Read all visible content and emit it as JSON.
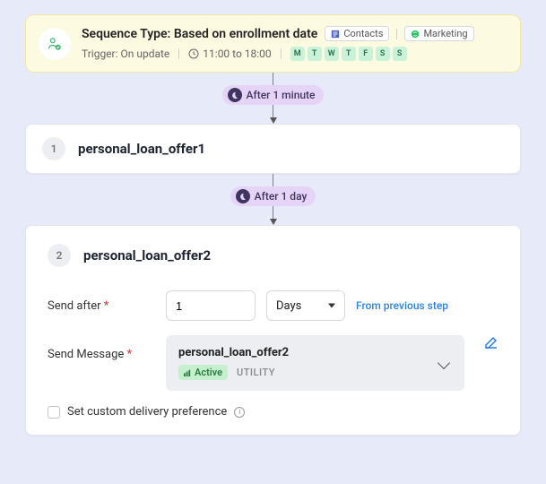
{
  "sequence": {
    "title": "Sequence Type: Based on enrollment date",
    "tags": {
      "contacts": "Contacts",
      "marketing": "Marketing"
    },
    "trigger_label": "Trigger: On update",
    "time_window": "11:00 to 18:00",
    "days": [
      "M",
      "T",
      "W",
      "T",
      "F",
      "S",
      "S"
    ]
  },
  "delays": {
    "d1": "After 1 minute",
    "d2": "After 1 day"
  },
  "step1": {
    "num": "1",
    "name": "personal_loan_offer1"
  },
  "step2": {
    "num": "2",
    "name": "personal_loan_offer2",
    "send_after_label": "Send after",
    "send_after_value": "1",
    "send_after_unit": "Days",
    "from_prev": "From previous step",
    "send_message_label": "Send Message",
    "message_name": "personal_loan_offer2",
    "active_label": "Active",
    "utility_label": "UTILITY",
    "custom_pref": "Set custom delivery preference"
  }
}
